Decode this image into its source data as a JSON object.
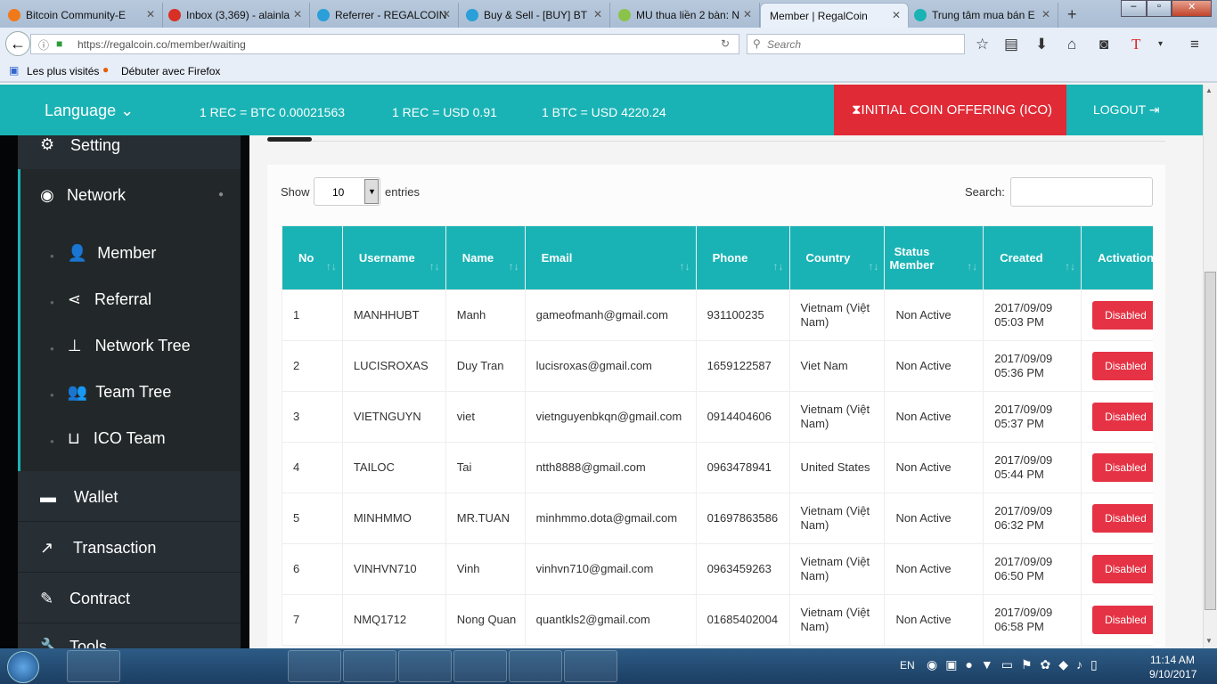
{
  "browser": {
    "tabs": [
      {
        "title": "Bitcoin Community-E",
        "color": "#f07a1a"
      },
      {
        "title": "Inbox (3,369) - alainla",
        "color": "#d93025"
      },
      {
        "title": "Referrer - REGALCOIN",
        "color": "#2a9fd8"
      },
      {
        "title": "Buy & Sell - [BUY] BT",
        "color": "#2a9fd8"
      },
      {
        "title": "MU thua liền 2 bàn: N",
        "color": "#8bc34a"
      },
      {
        "title": "Member | RegalCoin",
        "color": ""
      },
      {
        "title": "Trung tâm mua bán E",
        "color": "#1ab3b5"
      }
    ],
    "url": "https://regalcoin.co/member/waiting",
    "search_placeholder": "Search",
    "bookmarks": [
      "Les plus visités",
      "Débuter avec Firefox"
    ]
  },
  "header": {
    "language": "Language",
    "rates": [
      "1 REC = BTC 0.00021563",
      "1 REC = USD 0.91",
      "1 BTC = USD 4220.24"
    ],
    "ico": "INITIAL COIN OFFERING (ICO)",
    "logout": "LOGOUT"
  },
  "sidebar": {
    "setting": "Setting",
    "network": "Network",
    "sub": [
      "Member",
      "Referral",
      "Network Tree",
      "Team Tree",
      "ICO Team"
    ],
    "wallet": "Wallet",
    "transaction": "Transaction",
    "contract": "Contract",
    "tools": "Tools"
  },
  "table": {
    "show": "Show",
    "entries_value": "10",
    "entries": "entries",
    "search_label": "Search:",
    "columns": [
      "No",
      "Username",
      "Name",
      "Email",
      "Phone",
      "Country",
      "Status Member",
      "Created",
      "Activation"
    ],
    "rows": [
      [
        "1",
        "MANHHUBT",
        "Manh",
        "gameofmanh@gmail.com",
        "931100235",
        "Vietnam (Việt Nam)",
        "Non Active",
        "2017/09/09 05:03 PM",
        "Disabled"
      ],
      [
        "2",
        "LUCISROXAS",
        "Duy Tran",
        "lucisroxas@gmail.com",
        "1659122587",
        "Viet Nam",
        "Non Active",
        "2017/09/09 05:36 PM",
        "Disabled"
      ],
      [
        "3",
        "VIETNGUYN",
        "viet",
        "vietnguyenbkqn@gmail.com",
        "0914404606",
        "Vietnam (Việt Nam)",
        "Non Active",
        "2017/09/09 05:37 PM",
        "Disabled"
      ],
      [
        "4",
        "TAILOC",
        "Tai",
        "ntth8888@gmail.com",
        "0963478941",
        "United States",
        "Non Active",
        "2017/09/09 05:44 PM",
        "Disabled"
      ],
      [
        "5",
        "MINHMMO",
        "MR.TUAN",
        "minhmmo.dota@gmail.com",
        "01697863586",
        "Vietnam (Việt Nam)",
        "Non Active",
        "2017/09/09 06:32 PM",
        "Disabled"
      ],
      [
        "6",
        "VINHVN710",
        "Vinh",
        "vinhvn710@gmail.com",
        "0963459263",
        "Vietnam (Việt Nam)",
        "Non Active",
        "2017/09/09 06:50 PM",
        "Disabled"
      ],
      [
        "7",
        "NMQ1712",
        "Nong Quan",
        "quantkls2@gmail.com",
        "01685402004",
        "Vietnam (Việt Nam)",
        "Non Active",
        "2017/09/09 06:58 PM",
        "Disabled"
      ]
    ]
  },
  "taskbar": {
    "lang": "EN",
    "time": "11:14 AM",
    "date": "9/10/2017"
  }
}
